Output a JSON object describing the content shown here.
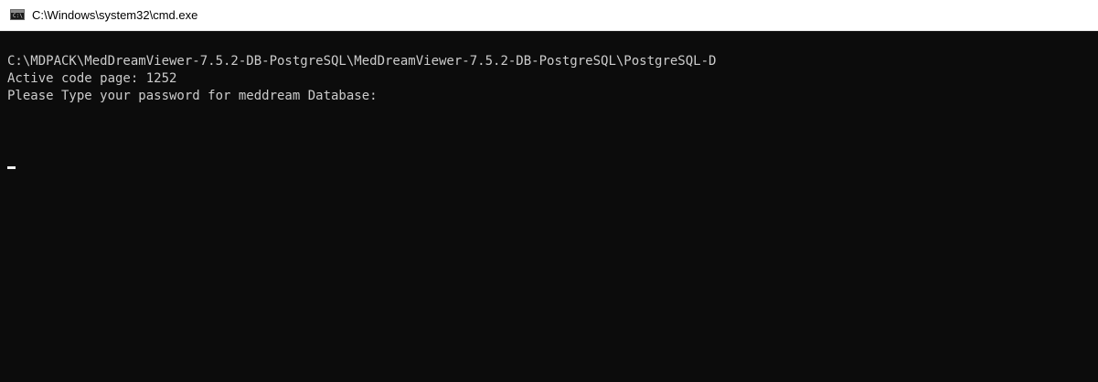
{
  "window": {
    "title": "C:\\Windows\\system32\\cmd.exe",
    "icon": "cmd-icon",
    "icon_glyph": "C:\\"
  },
  "console": {
    "lines": [
      "C:\\MDPACK\\MedDreamViewer-7.5.2-DB-PostgreSQL\\MedDreamViewer-7.5.2-DB-PostgreSQL\\PostgreSQL-D",
      "Active code page: 1252",
      "Please Type your password for meddream Database:"
    ],
    "input_value": "",
    "colors": {
      "background": "#0c0c0c",
      "text": "#cccccc",
      "cursor": "#f2f2f2"
    }
  }
}
